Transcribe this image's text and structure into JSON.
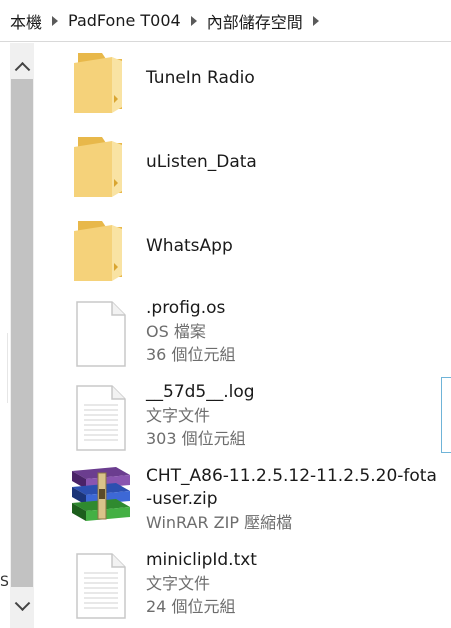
{
  "breadcrumb": {
    "items": [
      "本機",
      "PadFone T004",
      "內部儲存空間"
    ]
  },
  "left_pane": {
    "partial_text": "S"
  },
  "files": [
    {
      "name": "TuneIn Radio",
      "type": "folder",
      "icon": "folder-icon"
    },
    {
      "name": "uListen_Data",
      "type": "folder",
      "icon": "folder-icon"
    },
    {
      "name": "WhatsApp",
      "type": "folder",
      "icon": "folder-icon"
    },
    {
      "name": ".profig.os",
      "kind": "OS 檔案",
      "size": "36 個位元組",
      "icon": "blank-document-icon"
    },
    {
      "name": "__57d5__.log",
      "kind": "文字文件",
      "size": "303 個位元組",
      "icon": "text-document-icon"
    },
    {
      "name_line1": "CHT_A86-11.2.5.12-11.2.5.20-fota",
      "name_line2": "-user.zip",
      "kind": "WinRAR ZIP 壓縮檔",
      "icon": "winrar-archive-icon"
    },
    {
      "name": "miniclipId.txt",
      "kind": "文字文件",
      "size": "24 個位元組",
      "icon": "text-document-icon"
    }
  ],
  "colors": {
    "folder_front": "#f5d27a",
    "folder_back": "#e8b84a",
    "scroll_thumb": "#c2c2c2",
    "selection_edge": "#6fb4d8"
  }
}
